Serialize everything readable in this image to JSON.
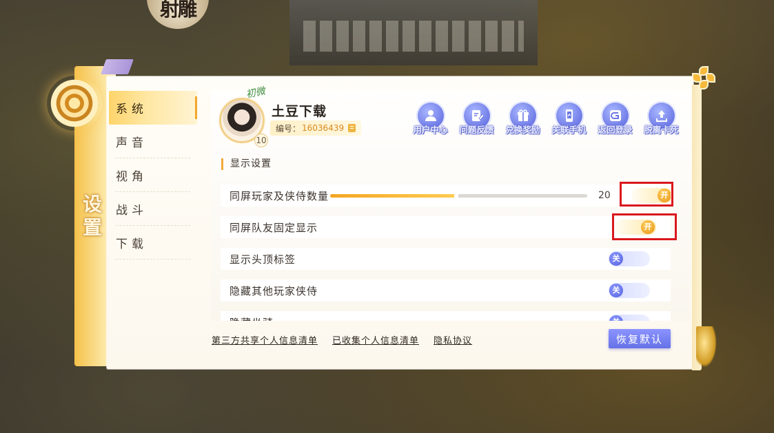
{
  "game": {
    "logo_text": "射雕"
  },
  "panel": {
    "title": "设置"
  },
  "sidebar": {
    "items": [
      {
        "label": "系统",
        "active": true
      },
      {
        "label": "声音",
        "active": false
      },
      {
        "label": "视角",
        "active": false
      },
      {
        "label": "战斗",
        "active": false
      },
      {
        "label": "下载",
        "active": false
      }
    ]
  },
  "profile": {
    "avatar_tag": "初微",
    "level": "10",
    "name": "土豆下载",
    "id_label": "编号：",
    "id_value": "16036439"
  },
  "quick_actions": [
    {
      "label": "用户中心",
      "icon": "user-icon"
    },
    {
      "label": "问题反馈",
      "icon": "feedback-icon"
    },
    {
      "label": "兑换奖励",
      "icon": "gift-icon"
    },
    {
      "label": "关联手机",
      "icon": "phone-icon"
    },
    {
      "label": "返回登录",
      "icon": "return-icon"
    },
    {
      "label": "脱离卡死",
      "icon": "escape-icon"
    }
  ],
  "display_settings": {
    "section_title": "显示设置",
    "rows": [
      {
        "label": "同屏玩家及侠侍数量",
        "type": "slider",
        "value": "20",
        "fill_fraction": 0.49,
        "toggle": "开",
        "toggle_state": "on",
        "highlighted": true
      },
      {
        "label": "同屏队友固定显示",
        "type": "toggle",
        "toggle": "开",
        "toggle_state": "on",
        "highlighted": true
      },
      {
        "label": "显示头顶标签",
        "type": "toggle",
        "toggle": "关",
        "toggle_state": "off",
        "highlighted": false
      },
      {
        "label": "隐藏其他玩家侠侍",
        "type": "toggle",
        "toggle": "关",
        "toggle_state": "off",
        "highlighted": false
      },
      {
        "label": "隐藏坐骑",
        "type": "toggle",
        "toggle": "关",
        "toggle_state": "off",
        "highlighted": false
      }
    ]
  },
  "footer": {
    "links": [
      "第三方共享个人信息清单",
      "已收集个人信息清单",
      "隐私协议"
    ],
    "reset_label": "恢复默认"
  },
  "colors": {
    "accent_gold": "#f3a623",
    "button_purple": "#6b77e4",
    "highlight_red": "#d9181c"
  }
}
